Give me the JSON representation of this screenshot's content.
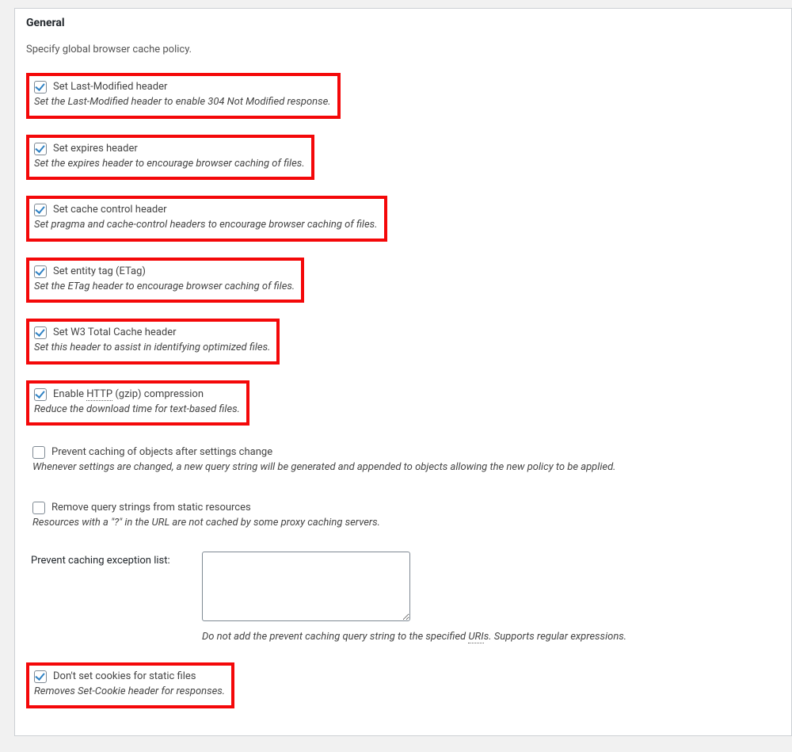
{
  "panel": {
    "title": "General",
    "intro": "Specify global browser cache policy."
  },
  "options": {
    "last_modified": {
      "label": "Set Last-Modified header",
      "desc": "Set the Last-Modified header to enable 304 Not Modified response.",
      "checked": true,
      "highlighted": true
    },
    "expires": {
      "label": "Set expires header",
      "desc": "Set the expires header to encourage browser caching of files.",
      "checked": true,
      "highlighted": true
    },
    "cache_control": {
      "label": "Set cache control header",
      "desc": "Set pragma and cache-control headers to encourage browser caching of files.",
      "checked": true,
      "highlighted": true
    },
    "etag": {
      "label": "Set entity tag (ETag)",
      "desc": "Set the ETag header to encourage browser caching of files.",
      "checked": true,
      "highlighted": true
    },
    "w3tc": {
      "label": "Set W3 Total Cache header",
      "desc": "Set this header to assist in identifying optimized files.",
      "checked": true,
      "highlighted": true
    },
    "gzip": {
      "label_a": "Enable ",
      "label_http": "HTTP",
      "label_b": " (gzip) compression",
      "desc": "Reduce the download time for text-based files.",
      "checked": true,
      "highlighted": true
    },
    "prevent_after_change": {
      "label": "Prevent caching of objects after settings change",
      "desc": "Whenever settings are changed, a new query string will be generated and appended to objects allowing the new policy to be applied.",
      "checked": false,
      "highlighted": false
    },
    "remove_query": {
      "label": "Remove query strings from static resources",
      "desc": "Resources with a \"?\" in the URL are not cached by some proxy caching servers.",
      "checked": false,
      "highlighted": false
    },
    "no_cookies": {
      "label": "Don't set cookies for static files",
      "desc": "Removes Set-Cookie header for responses.",
      "checked": true,
      "highlighted": true
    }
  },
  "exception": {
    "label": "Prevent caching exception list:",
    "value": "",
    "desc_a": "Do not add the prevent caching query string to the specified ",
    "desc_uri": "URI",
    "desc_b": "s. Supports regular expressions."
  }
}
